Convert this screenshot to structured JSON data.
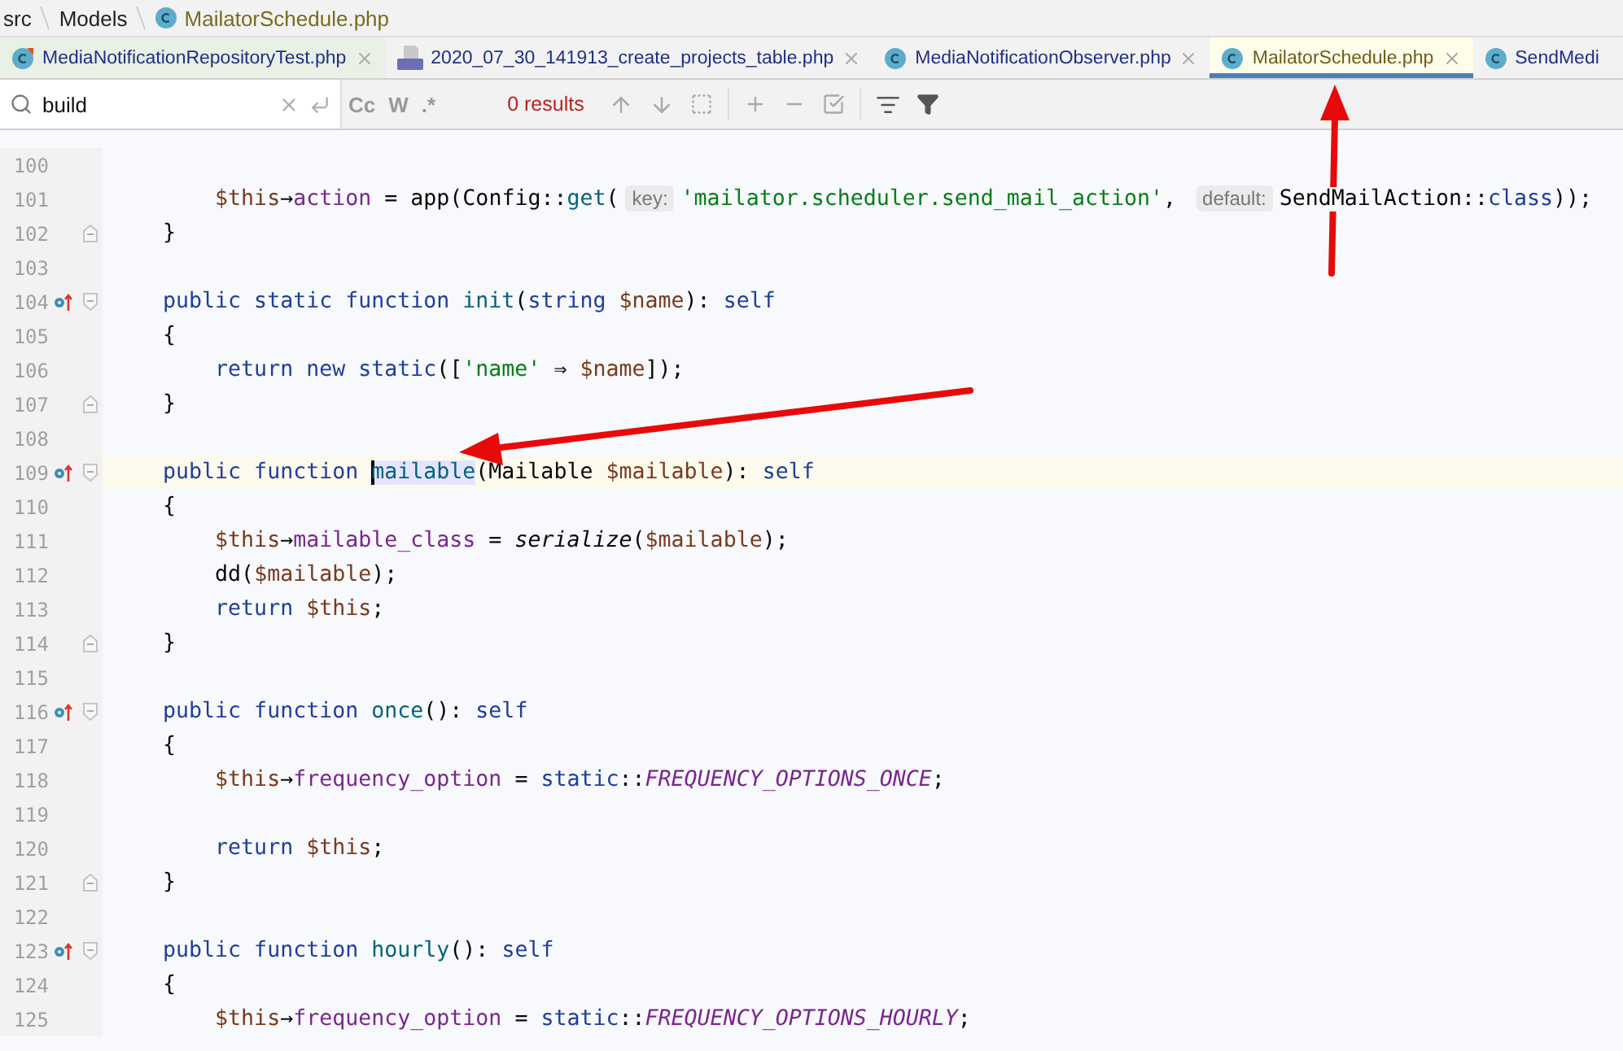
{
  "breadcrumb": [
    {
      "label": "src"
    },
    {
      "label": "Models"
    },
    {
      "label": "MailatorSchedule.php",
      "kind": "class"
    }
  ],
  "tabs": [
    {
      "label": "MediaNotificationRepositoryTest.php",
      "kind": "test",
      "selected": false,
      "closable": true
    },
    {
      "label": "2020_07_30_141913_create_projects_table.php",
      "kind": "php",
      "selected": false,
      "closable": true
    },
    {
      "label": "MediaNotificationObserver.php",
      "kind": "class",
      "selected": false,
      "closable": true
    },
    {
      "label": "MailatorSchedule.php",
      "kind": "class",
      "selected": true,
      "closable": true
    },
    {
      "label": "SendMedi",
      "kind": "class",
      "selected": false,
      "closable": false
    }
  ],
  "find_bar": {
    "value": "build",
    "options": [
      "Cc",
      "W",
      ".*"
    ],
    "result": "0 results"
  },
  "editor": {
    "lines": [
      {
        "number": "100"
      },
      {
        "number": "101",
        "tokens": [
          {
            "text": "        $this",
            "kind": "var"
          },
          {
            "text": "→",
            "kind": "plain"
          },
          {
            "text": "action",
            "kind": "prop"
          },
          {
            "text": " = app(Config::",
            "kind": "plain"
          },
          {
            "text": "get",
            "kind": "fn"
          },
          {
            "text": "(",
            "kind": "plain"
          },
          {
            "text": "key:",
            "kind": "hint"
          },
          {
            "text": "'mailator.scheduler.send_mail_action'",
            "kind": "str"
          },
          {
            "text": ", ",
            "kind": "plain"
          },
          {
            "text": "default:",
            "kind": "hint"
          },
          {
            "text": "SendMailAction::",
            "kind": "plain"
          },
          {
            "text": "class",
            "kind": "kw"
          },
          {
            "text": "));",
            "kind": "plain"
          }
        ]
      },
      {
        "number": "102",
        "fold_end": true,
        "tokens": [
          {
            "text": "    }",
            "kind": "plain"
          }
        ]
      },
      {
        "number": "103"
      },
      {
        "number": "104",
        "marker": true,
        "fold_start": true,
        "tokens": [
          {
            "text": "    public static function",
            "kind": "kw"
          },
          {
            "text": " init",
            "kind": "fn"
          },
          {
            "text": "(",
            "kind": "plain"
          },
          {
            "text": "string",
            "kind": "kw"
          },
          {
            "text": " $name",
            "kind": "var"
          },
          {
            "text": "): ",
            "kind": "plain"
          },
          {
            "text": "self",
            "kind": "kw"
          }
        ]
      },
      {
        "number": "105",
        "tokens": [
          {
            "text": "    {",
            "kind": "plain"
          }
        ]
      },
      {
        "number": "106",
        "tokens": [
          {
            "text": "        return new static",
            "kind": "kw"
          },
          {
            "text": "([",
            "kind": "plain"
          },
          {
            "text": "'name'",
            "kind": "str"
          },
          {
            "text": " ⇒ ",
            "kind": "plain"
          },
          {
            "text": "$name",
            "kind": "var"
          },
          {
            "text": "]);",
            "kind": "plain"
          }
        ]
      },
      {
        "number": "107",
        "fold_end": true,
        "tokens": [
          {
            "text": "    }",
            "kind": "plain"
          }
        ]
      },
      {
        "number": "108"
      },
      {
        "number": "109",
        "marker": true,
        "fold_start": true,
        "current": true,
        "tokens": [
          {
            "text": "    public function ",
            "kind": "kw"
          },
          {
            "text": "mailable",
            "kind": "fn",
            "highlighted": true,
            "caret": true
          },
          {
            "text": "(Mailable ",
            "kind": "plain"
          },
          {
            "text": "$mailable",
            "kind": "var"
          },
          {
            "text": "): ",
            "kind": "plain"
          },
          {
            "text": "self",
            "kind": "kw"
          }
        ]
      },
      {
        "number": "110",
        "tokens": [
          {
            "text": "    {",
            "kind": "plain"
          }
        ]
      },
      {
        "number": "111",
        "tokens": [
          {
            "text": "        $this",
            "kind": "var"
          },
          {
            "text": "→",
            "kind": "plain"
          },
          {
            "text": "mailable_class",
            "kind": "prop"
          },
          {
            "text": " = ",
            "kind": "plain"
          },
          {
            "text": "serialize",
            "kind": "italic"
          },
          {
            "text": "(",
            "kind": "plain"
          },
          {
            "text": "$mailable",
            "kind": "var"
          },
          {
            "text": ");",
            "kind": "plain"
          }
        ]
      },
      {
        "number": "112",
        "tokens": [
          {
            "text": "        dd(",
            "kind": "plain"
          },
          {
            "text": "$mailable",
            "kind": "var"
          },
          {
            "text": ");",
            "kind": "plain"
          }
        ]
      },
      {
        "number": "113",
        "tokens": [
          {
            "text": "        return",
            "kind": "kw"
          },
          {
            "text": " $this",
            "kind": "var"
          },
          {
            "text": ";",
            "kind": "plain"
          }
        ]
      },
      {
        "number": "114",
        "fold_end": true,
        "tokens": [
          {
            "text": "    }",
            "kind": "plain"
          }
        ]
      },
      {
        "number": "115"
      },
      {
        "number": "116",
        "marker": true,
        "fold_start": true,
        "tokens": [
          {
            "text": "    public function",
            "kind": "kw"
          },
          {
            "text": " once",
            "kind": "fn"
          },
          {
            "text": "(): ",
            "kind": "plain"
          },
          {
            "text": "self",
            "kind": "kw"
          }
        ]
      },
      {
        "number": "117",
        "tokens": [
          {
            "text": "    {",
            "kind": "plain"
          }
        ]
      },
      {
        "number": "118",
        "tokens": [
          {
            "text": "        $this",
            "kind": "var"
          },
          {
            "text": "→",
            "kind": "plain"
          },
          {
            "text": "frequency_option",
            "kind": "prop"
          },
          {
            "text": " = ",
            "kind": "plain"
          },
          {
            "text": "static",
            "kind": "kw"
          },
          {
            "text": "::",
            "kind": "plain"
          },
          {
            "text": "FREQUENCY_OPTIONS_ONCE",
            "kind": "const"
          },
          {
            "text": ";",
            "kind": "plain"
          }
        ]
      },
      {
        "number": "119"
      },
      {
        "number": "120",
        "tokens": [
          {
            "text": "        return",
            "kind": "kw"
          },
          {
            "text": " $this",
            "kind": "var"
          },
          {
            "text": ";",
            "kind": "plain"
          }
        ]
      },
      {
        "number": "121",
        "fold_end": true,
        "tokens": [
          {
            "text": "    }",
            "kind": "plain"
          }
        ]
      },
      {
        "number": "122"
      },
      {
        "number": "123",
        "marker": true,
        "fold_start": true,
        "tokens": [
          {
            "text": "    public function",
            "kind": "kw"
          },
          {
            "text": " hourly",
            "kind": "fn"
          },
          {
            "text": "(): ",
            "kind": "plain"
          },
          {
            "text": "self",
            "kind": "kw"
          }
        ]
      },
      {
        "number": "124",
        "tokens": [
          {
            "text": "    {",
            "kind": "plain"
          }
        ]
      },
      {
        "number": "125",
        "tokens": [
          {
            "text": "        $this",
            "kind": "var"
          },
          {
            "text": "→",
            "kind": "plain"
          },
          {
            "text": "frequency_option",
            "kind": "prop"
          },
          {
            "text": " = ",
            "kind": "plain"
          },
          {
            "text": "static",
            "kind": "kw"
          },
          {
            "text": "::",
            "kind": "plain"
          },
          {
            "text": "FREQUENCY_OPTIONS_HOURLY",
            "kind": "const"
          },
          {
            "text": ";",
            "kind": "plain"
          }
        ]
      }
    ]
  }
}
